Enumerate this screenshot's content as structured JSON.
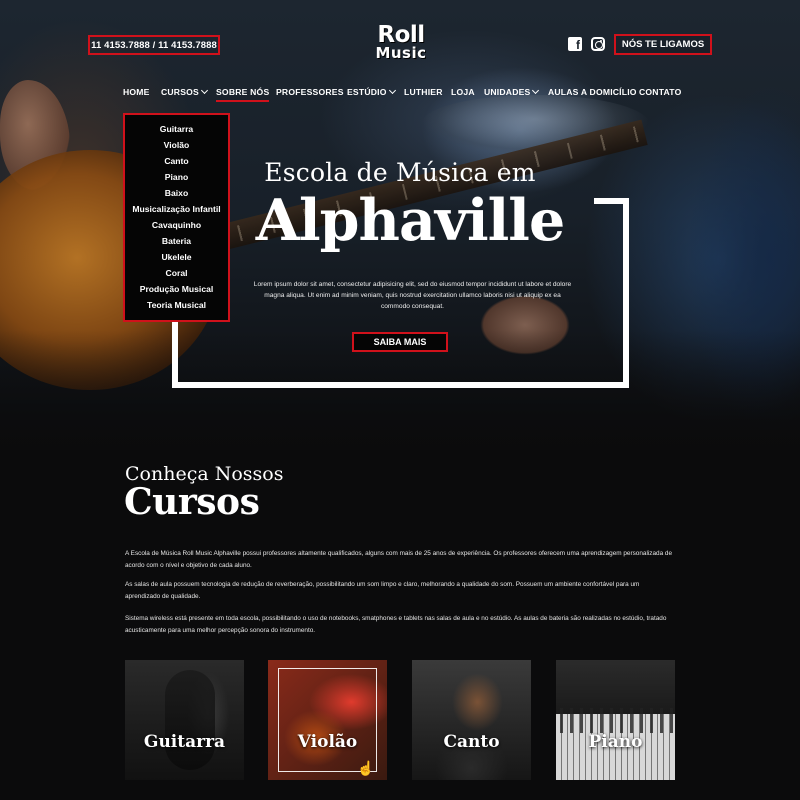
{
  "header": {
    "phone": "11 4153.7888 / 11 4153.7888",
    "logo_line1": "Roll",
    "logo_line2": "Music",
    "callback_label": "NÓS TE LIGAMOS",
    "social": [
      "facebook-icon",
      "instagram-icon"
    ]
  },
  "nav": {
    "items": [
      {
        "label": "HOME"
      },
      {
        "label": "CURSOS"
      },
      {
        "label": "SOBRE NÓS"
      },
      {
        "label": "PROFESSORES"
      },
      {
        "label": "ESTÚDIO"
      },
      {
        "label": "LUTHIER"
      },
      {
        "label": "LOJA"
      },
      {
        "label": "UNIDADES"
      },
      {
        "label": "AULAS A DOMICÍLIO"
      },
      {
        "label": "CONTATO"
      }
    ]
  },
  "dropdown": {
    "items": [
      "Guitarra",
      "Violão",
      "Canto",
      "Piano",
      "Baixo",
      "Musicalização Infantil",
      "Cavaquinho",
      "Bateria",
      "Ukelele",
      "Coral",
      "Produção Musical",
      "Teoria Musical"
    ]
  },
  "hero": {
    "subtitle": "Escola de Música em",
    "title": "Alphaville",
    "text": "Lorem ipsum dolor sit amet, consectetur adipisicing elit, sed do eiusmod tempor incididunt ut labore et dolore magna aliqua. Ut enim ad minim veniam, quis nostrud exercitation ullamco laboris nisi ut aliquip ex ea commodo consequat.",
    "button": "SAIBA MAIS"
  },
  "section": {
    "subtitle": "Conheça Nossos",
    "title": "Cursos",
    "paragraphs": [
      "A Escola de Música Roll Music Alphaville possui professores altamente qualificados, alguns com mais de 25 anos de experiência. Os professores oferecem uma aprendizagem personalizada de acordo com o nível e objetivo de cada aluno.",
      "As salas de aula possuem tecnologia de redução de reverberação, possibilitando um som limpo e claro, melhorando a qualidade do som. Possuem um ambiente confortável para um aprendizado de qualidade.",
      "Sistema wireless está presente em toda escola, possibilitando o uso de notebooks, smatphones e tablets nas salas de aula e no estúdio. As aulas de bateria são realizadas no estúdio, tratado acusticamente para uma melhor percepção sonora do instrumento."
    ]
  },
  "cards": [
    {
      "label": "Guitarra"
    },
    {
      "label": "Violão"
    },
    {
      "label": "Canto"
    },
    {
      "label": "Piano"
    }
  ],
  "colors": {
    "accent": "#d0111b",
    "background": "#0b0b0c",
    "text": "#ffffff"
  }
}
